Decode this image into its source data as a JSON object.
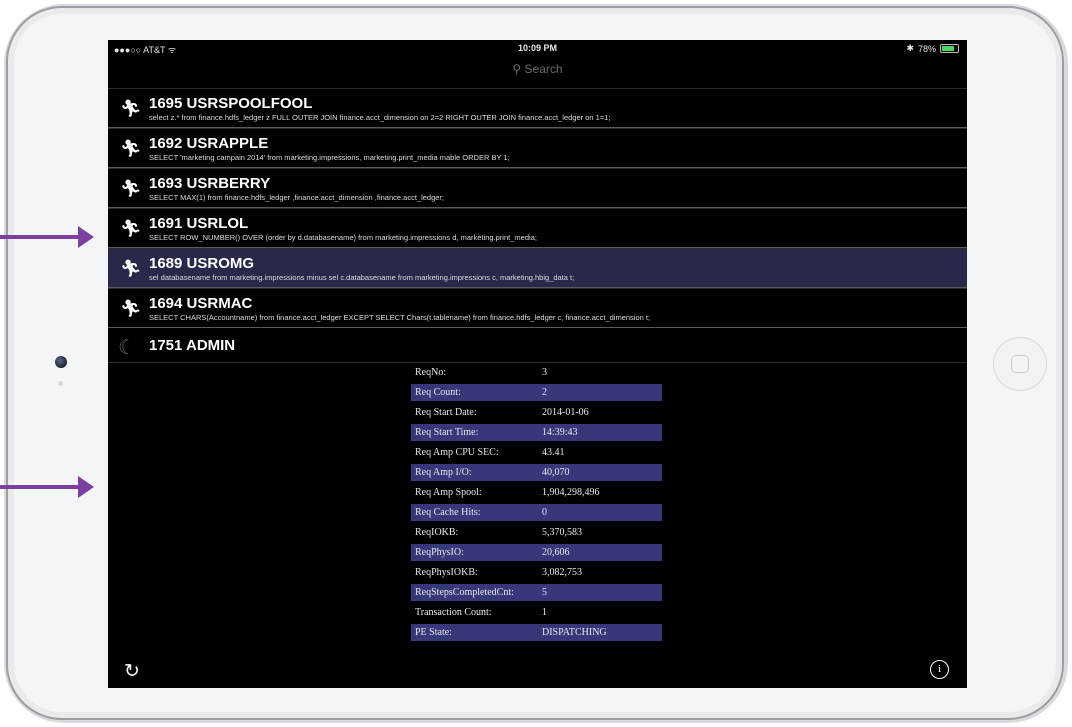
{
  "status_bar": {
    "carrier": "●●●○○ AT&T ᯤ",
    "time": "10:09 PM",
    "battery": "78%"
  },
  "search": {
    "label": "⚲ Search"
  },
  "sessions": [
    {
      "title": "1695 USRSPOOLFOOL",
      "sql": "select z.* from  finance.hdfs_ledger z FULL OUTER JOIN finance.acct_dimension on 2=2 RIGHT OUTER JOIN finance.acct_ledger on 1=1;",
      "icon": "running-icon"
    },
    {
      "title": "1692 USRAPPLE",
      "sql": "SELECT 'marketing campain 2014'  from marketing.impressions, marketing.print_media mable  ORDER BY 1;",
      "icon": "running-icon"
    },
    {
      "title": "1693 USRBERRY",
      "sql": "SELECT MAX(1) from finance.hdfs_ledger ,finance.acct_dimension ,finance.acct_ledger;",
      "icon": "running-icon"
    },
    {
      "title": "1691 USRLOL",
      "sql": "SELECT ROW_NUMBER() OVER (order by d.databasename) from marketing.impressions d, marketing.print_media;",
      "icon": "running-icon"
    },
    {
      "title": "1689 USROMG",
      "sql": "sel databasename from marketing.impressions minus sel c.databasename from marketing.impressions c, marketing.hbig_data t;",
      "icon": "running-icon",
      "selected": true
    },
    {
      "title": "1694 USRMAC",
      "sql": "SELECT CHARS(Accountname) from finance.acct_ledger EXCEPT SELECT Chars(t.tablename) from finance.hdfs_ledger c, finance.acct_dimension t;",
      "icon": "running-icon"
    }
  ],
  "admin": {
    "title": "1751 ADMIN",
    "icon": "moon-icon"
  },
  "details": [
    {
      "key": "ReqNo:",
      "value": "3"
    },
    {
      "key": "Req Count:",
      "value": "2"
    },
    {
      "key": "Req Start Date:",
      "value": "2014-01-06"
    },
    {
      "key": "Req Start Time:",
      "value": "14:39:43"
    },
    {
      "key": "Req Amp CPU SEC:",
      "value": "43.41"
    },
    {
      "key": "Req Amp I/O:",
      "value": "40,070"
    },
    {
      "key": "Req Amp Spool:",
      "value": "1,904,298,496"
    },
    {
      "key": "Req Cache Hits:",
      "value": "0"
    },
    {
      "key": "ReqIOKB:",
      "value": "5,370,583"
    },
    {
      "key": "ReqPhysIO:",
      "value": "20,606"
    },
    {
      "key": "ReqPhysIOKB:",
      "value": "3,082,753"
    },
    {
      "key": "ReqStepsCompletedCnt:",
      "value": "5"
    },
    {
      "key": "Transaction Count:",
      "value": "1"
    },
    {
      "key": "PE State:",
      "value": "DISPATCHING"
    }
  ],
  "toolbar": {
    "refresh_icon": "refresh-icon",
    "info_icon": "info-icon",
    "info_glyph": "i"
  },
  "colors": {
    "selected_row": "#27284a",
    "detail_highlight": "#36387a",
    "annotation_arrow": "#7b3fa0"
  }
}
